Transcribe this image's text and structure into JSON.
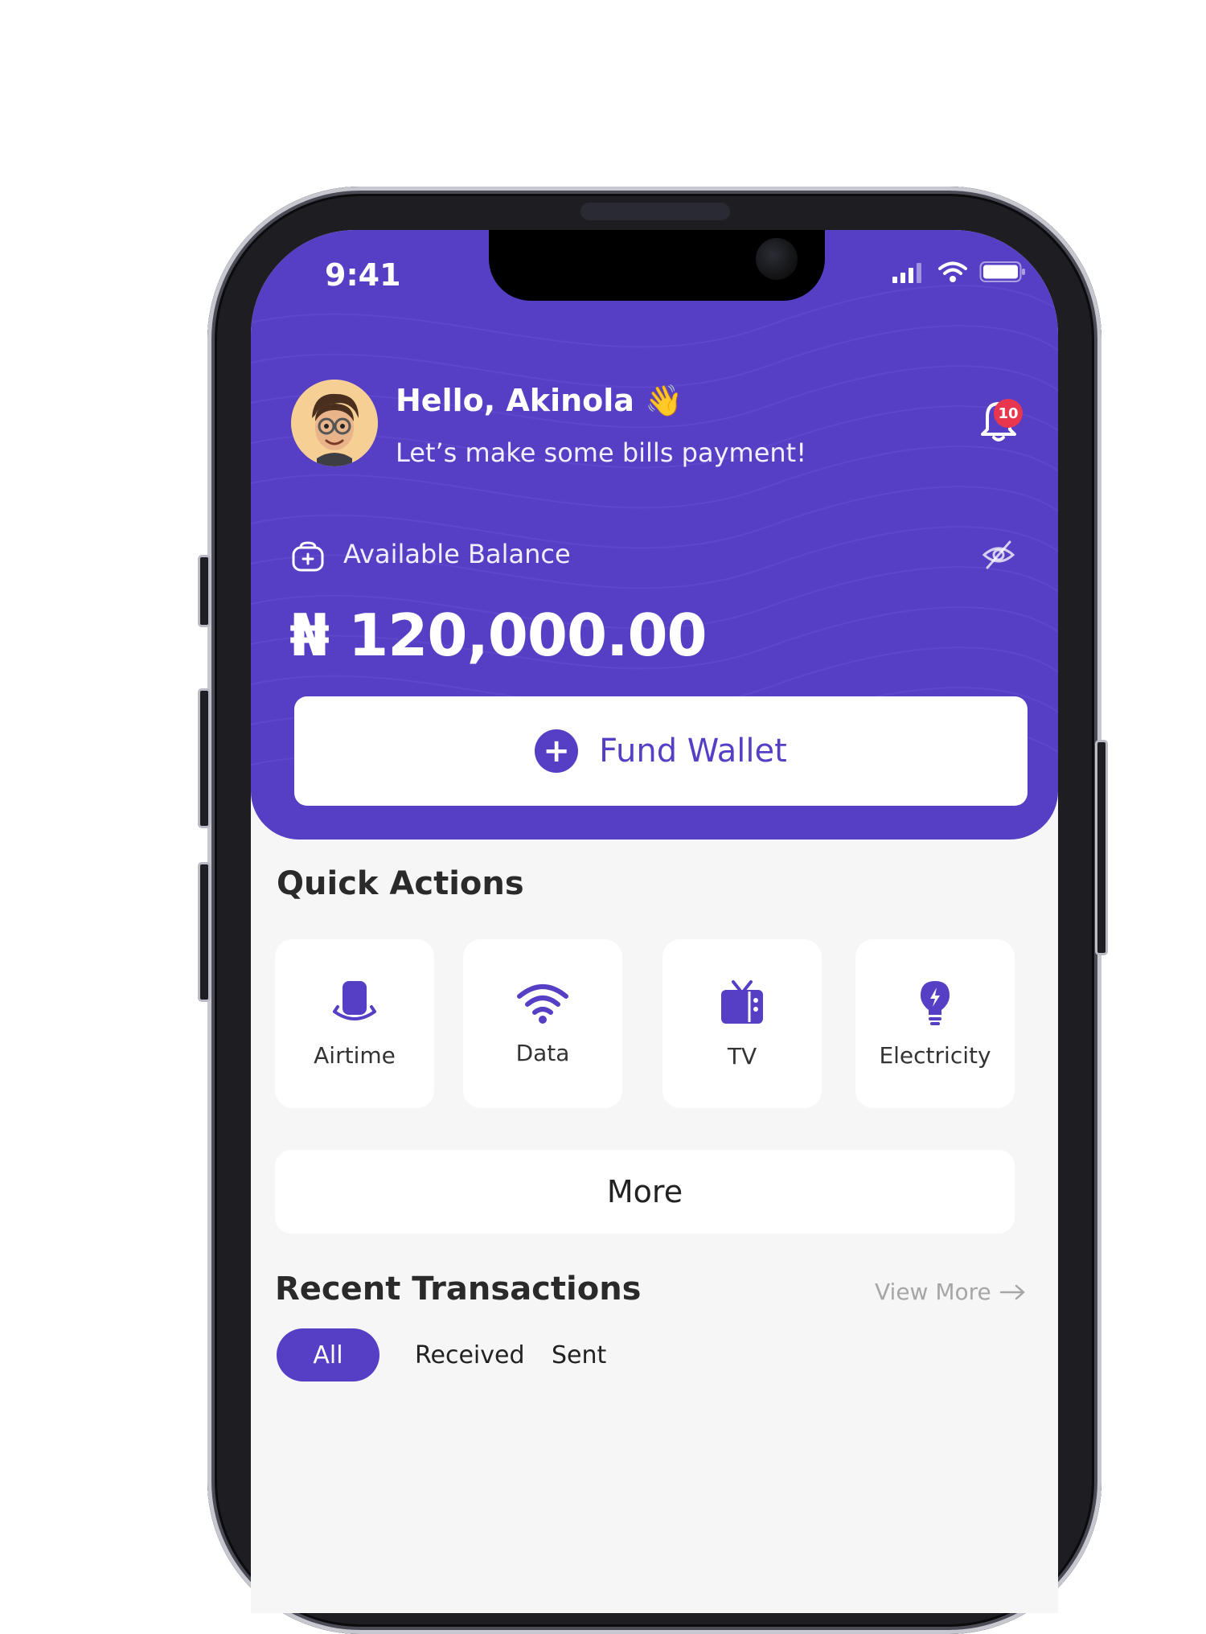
{
  "status_bar": {
    "time": "9:41"
  },
  "greeting": {
    "title": "Hello, Akinola",
    "emoji": "👋",
    "subtitle": "Let’s make some bills payment!",
    "notification_count": "10"
  },
  "balance": {
    "label": "Available Balance",
    "amount": "₦ 120,000.00"
  },
  "fund_wallet": {
    "label": "Fund Wallet"
  },
  "quick_actions": {
    "title": "Quick Actions",
    "items": [
      {
        "label": "Airtime",
        "icon": "airtime-icon"
      },
      {
        "label": "Data",
        "icon": "wifi-icon"
      },
      {
        "label": "TV",
        "icon": "tv-icon"
      },
      {
        "label": "Electricity",
        "icon": "bulb-icon"
      }
    ],
    "more_label": "More"
  },
  "recent_transactions": {
    "title": "Recent Transactions",
    "view_more": "View More",
    "tabs": [
      "All",
      "Received",
      "Sent"
    ],
    "active_tab": "All"
  },
  "colors": {
    "brand": "#563fc5",
    "background": "#f6f6f6",
    "badge": "#e8364f"
  }
}
